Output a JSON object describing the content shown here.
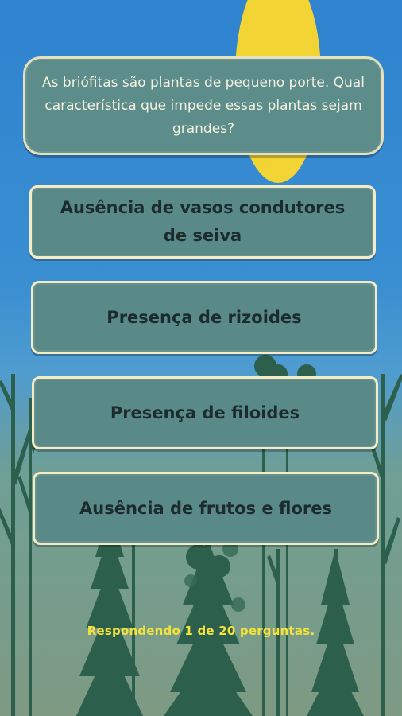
{
  "question": {
    "text": "As briófitas são plantas de pequeno porte. Qual característica que impede essas plantas sejam grandes?"
  },
  "answers": [
    {
      "label": "Ausência de vasos condutores de seiva"
    },
    {
      "label": "Presença de rizoides"
    },
    {
      "label": "Presença de filoides"
    },
    {
      "label": "Ausência de frutos e flores"
    }
  ],
  "progress": {
    "text": "Respondendo 1 de 20 perguntas."
  },
  "colors": {
    "sky": "#2f83cf",
    "sun": "#f2d435",
    "card": "#5a8a88",
    "card_border": "#f3ecc4",
    "trees": "#2b5b49",
    "progress_text": "#f5e23a"
  },
  "icons": [
    "sun-illustration",
    "forest-silhouette"
  ]
}
